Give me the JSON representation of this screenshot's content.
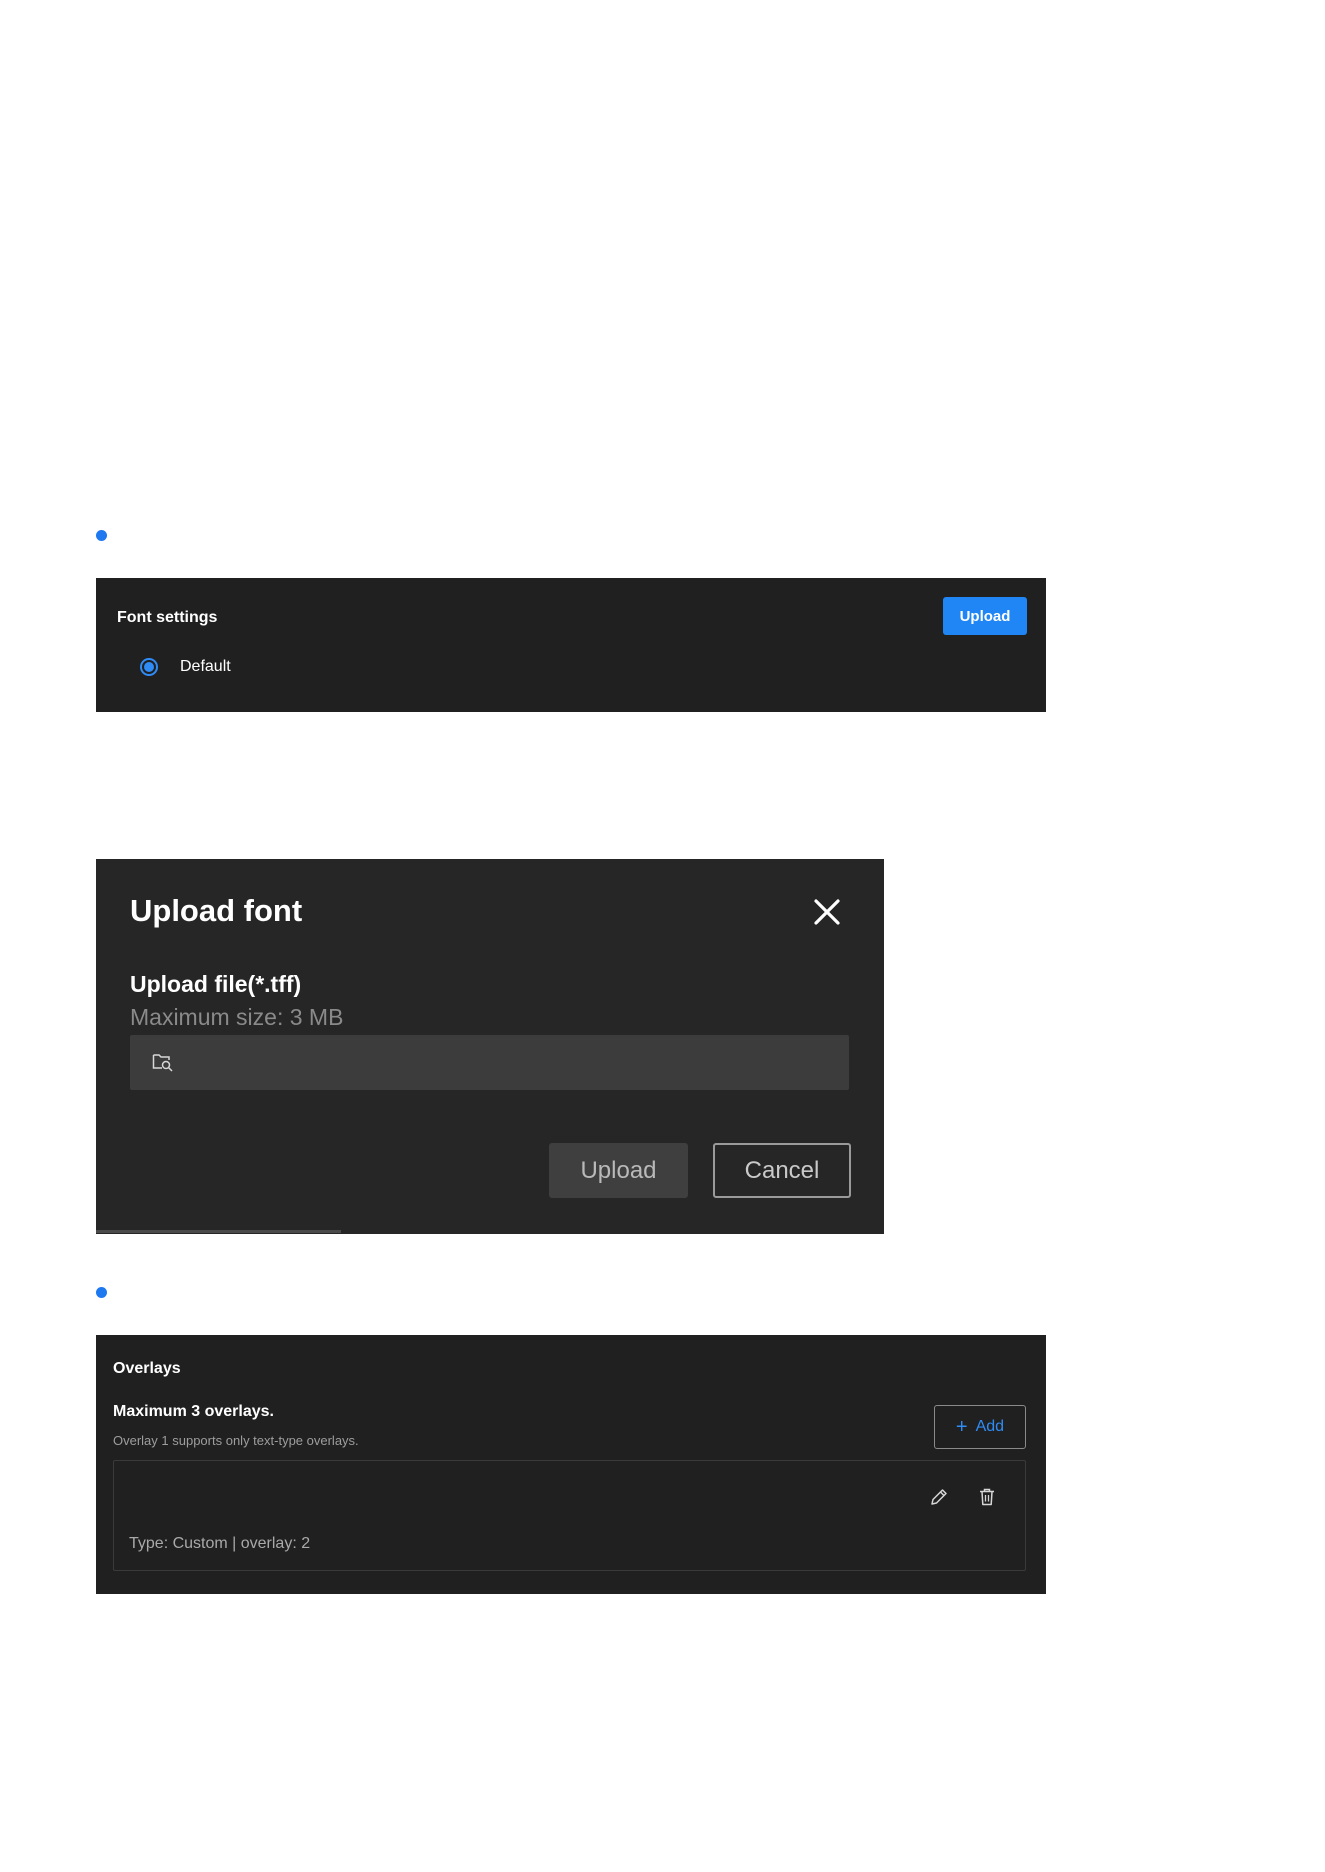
{
  "font_settings": {
    "title": "Font settings",
    "upload_label": "Upload",
    "radio_option": "Default",
    "radio_selected": true
  },
  "upload_dialog": {
    "title": "Upload font",
    "field_label": "Upload file(*.tff)",
    "field_hint": "Maximum size: 3 MB",
    "file_input_value": "",
    "upload_label": "Upload",
    "cancel_label": "Cancel"
  },
  "overlays": {
    "title": "Overlays",
    "max_text": "Maximum 3 overlays.",
    "hint": "Overlay 1 supports only text-type overlays.",
    "add_label": "Add",
    "items": [
      {
        "meta": "Type: Custom | overlay: 2"
      }
    ]
  },
  "colors": {
    "accent": "#2086f5",
    "panel_bg": "#202020",
    "dialog_bg": "#262626"
  }
}
